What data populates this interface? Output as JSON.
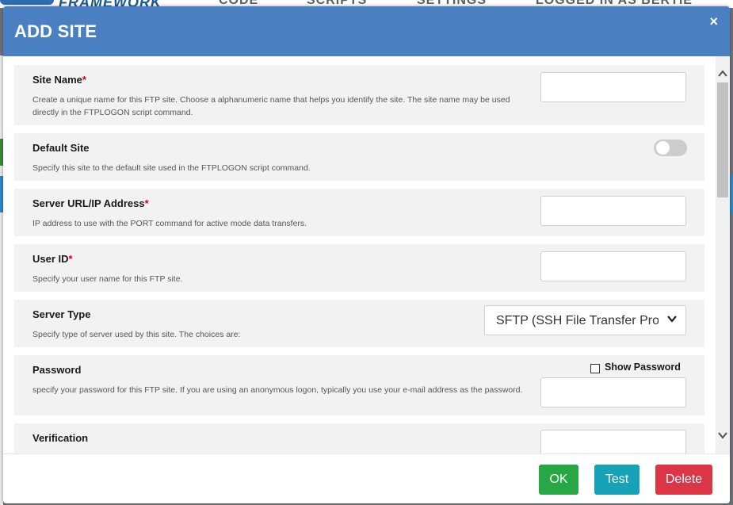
{
  "background": {
    "logo": "FRAMEWORK",
    "nav": [
      "CODE",
      "SCRIPTS",
      "SETTINGS",
      "LOGGED IN AS BERTIE"
    ]
  },
  "modal": {
    "title": "ADD SITE",
    "close_glyph": "×"
  },
  "fields": {
    "site_name": {
      "label": "Site Name",
      "required": "*",
      "description": "Create a unique name for this FTP site. Choose a alphanumeric name that helps you identify the site. The site name may be used directly in the FTPLOGON script command.",
      "value": ""
    },
    "default_site": {
      "label": "Default Site",
      "description": "Specify this site to the default site used in the FTPLOGON script command.",
      "toggled": false
    },
    "server_url": {
      "label": "Server URL/IP Address",
      "required": "*",
      "description": "IP address to use with the PORT command for active mode data transfers.",
      "value": ""
    },
    "user_id": {
      "label": "User ID",
      "required": "*",
      "description": "Specify your user name for this FTP site.",
      "value": ""
    },
    "server_type": {
      "label": "Server Type",
      "description": "Specify type of server used by this site. The choices are:",
      "selected": "SFTP (SSH File Transfer Protocol)"
    },
    "password": {
      "label": "Password",
      "description": "specify your password for this FTP site. If you are using an anonymous logon, typically you use your e-mail address as the password.",
      "show_password_label": "Show Password",
      "show_password_checked": false,
      "value": ""
    },
    "verification": {
      "label": "Verification",
      "value": ""
    }
  },
  "footer": {
    "ok_label": "OK",
    "test_label": "Test",
    "delete_label": "Delete"
  },
  "colors": {
    "header": "#4a80c2",
    "ok": "#28a745",
    "test": "#17a2b8",
    "delete": "#dc3545",
    "required": "#d0021b"
  }
}
